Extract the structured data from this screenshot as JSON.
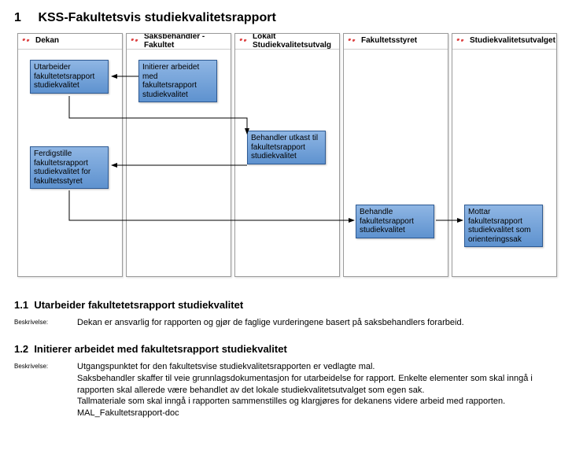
{
  "title_num": "1",
  "title": "KSS-Fakultetsvis studiekvalitetsrapport",
  "lanes": [
    {
      "label": "Dekan"
    },
    {
      "label": "Saksbehandler - Fakultet"
    },
    {
      "label": "Lokalt Studiekvalitetsutvalg"
    },
    {
      "label": "Fakultetsstyret"
    },
    {
      "label": "Studiekvalitetsutvalget"
    }
  ],
  "boxes": {
    "b1": "Utarbeider fakultetetsrapport studiekvalitet",
    "b2": "Initierer arbeidet med fakultetsrapport studiekvalitet",
    "b3": "Behandler utkast til fakultetsrapport studiekvalitet",
    "b4": "Ferdigstille fakultetsrapport studiekvalitet for fakultetsstyret",
    "b5": "Behandle fakultetsrapport studiekvalitet",
    "b6": "Mottar fakultetsrapport studiekvalitet som orienteringssak"
  },
  "sections": [
    {
      "num": "1.1",
      "title": "Utarbeider fakultetetsrapport studiekvalitet",
      "label": "Beskrivelse:",
      "body": "Dekan er ansvarlig for rapporten og gjør de faglige vurderingene basert på saksbehandlers forarbeid."
    },
    {
      "num": "1.2",
      "title": "Initierer arbeidet med fakultetsrapport studiekvalitet",
      "label": "Beskrivelse:",
      "body": "Utgangspunktet for den fakultetsvise studiekvalitetsrapporten er vedlagte mal.\nSaksbehandler skaffer til veie grunnlagsdokumentasjon for utarbeidelse for rapport. Enkelte elementer som skal inngå i rapporten skal allerede være behandlet av det lokale studiekvalitetsutvalget som egen sak.\nTallmateriale som skal inngå i rapporten sammenstilles og klargjøres for dekanens videre arbeid med rapporten.\nMAL_Fakultetsrapport-doc"
    }
  ]
}
